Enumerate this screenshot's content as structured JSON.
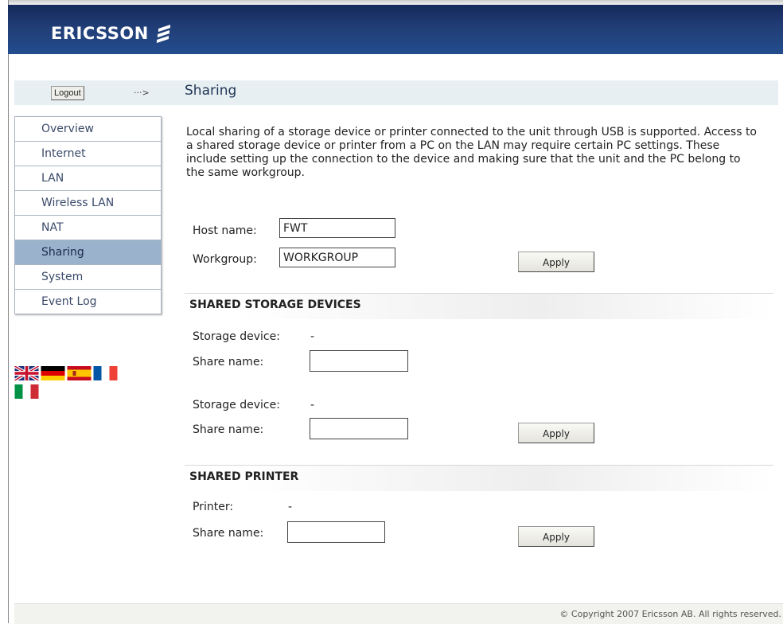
{
  "header": {
    "logo_text": "ERICSSON"
  },
  "topbar": {
    "logout_label": "Logout",
    "arrow": "···>",
    "page_title": "Sharing"
  },
  "sidebar": {
    "items": [
      {
        "label": "Overview"
      },
      {
        "label": "Internet"
      },
      {
        "label": "LAN"
      },
      {
        "label": "Wireless LAN"
      },
      {
        "label": "NAT"
      },
      {
        "label": "Sharing",
        "active": true
      },
      {
        "label": "System"
      },
      {
        "label": "Event Log"
      }
    ]
  },
  "languages": [
    "english-flag-icon",
    "german-flag-icon",
    "spanish-flag-icon",
    "french-flag-icon",
    "italian-flag-icon"
  ],
  "main": {
    "intro": "Local sharing of a storage device or printer connected to the unit through USB is supported. Access to a shared storage device or printer from a PC on the LAN may require certain PC settings. These include setting up the connection to the device and making sure that the unit and the PC belong to the same workgroup.",
    "host": {
      "label": "Host name:",
      "value": "FWT"
    },
    "workgroup": {
      "label": "Workgroup:",
      "value": "WORKGROUP"
    },
    "apply_label": "Apply",
    "storage": {
      "heading": "SHARED STORAGE DEVICES",
      "devices": [
        {
          "device_label": "Storage device:",
          "device_value": "-",
          "share_label": "Share name:",
          "share_value": ""
        },
        {
          "device_label": "Storage device:",
          "device_value": "-",
          "share_label": "Share name:",
          "share_value": ""
        }
      ]
    },
    "printer": {
      "heading": "SHARED PRINTER",
      "printer_label": "Printer:",
      "printer_value": "-",
      "share_label": "Share name:",
      "share_value": ""
    }
  },
  "footer": {
    "copyright": "© Copyright 2007 Ericsson AB. All rights reserved."
  },
  "colors": {
    "header": "#213d76",
    "active_nav": "#9ab2cb",
    "title_bar": "#e7eff3"
  }
}
